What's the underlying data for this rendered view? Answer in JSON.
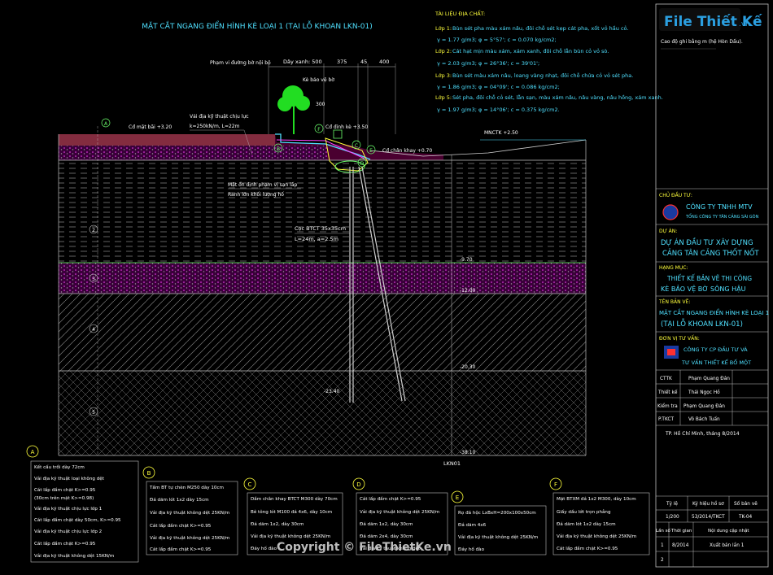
{
  "watermark": {
    "logo": "File Thiết Kế",
    "domain": ".vn",
    "copyright": "Copyright © FileThietKe.vn"
  },
  "title": "MẶT CẮT NGANG ĐIỂN HÌNH KÈ LOẠI 1 (TẠI LỖ KHOAN LKN-01)",
  "geology": {
    "header": "TÀI LIỆU ĐỊA CHẤT:",
    "layers": [
      {
        "name": "Lớp 1:",
        "desc": "Bùn sét pha màu xám nâu, đôi chỗ sét kẹp cát pha, xốt vỏ hầu cỏ.",
        "props": "γ = 1.77 g/m3; φ = 5°57'; c = 0.070 kg/cm2;"
      },
      {
        "name": "Lớp 2:",
        "desc": "Cát hạt mịn màu xám, xám xanh, đôi chỗ lẫn bùn cỏ vỏ sò.",
        "props": "γ = 2.03 g/m3; φ = 26°36'; c = 39'01';"
      },
      {
        "name": "Lớp 3:",
        "desc": "Bùn sét màu xám nâu, loang vàng nhạt, đôi chỗ chứa cỏ vỏ sét pha.",
        "props": "γ = 1.86 g/m3; φ = 04°09'; c = 0.086 kg/cm2;"
      },
      {
        "name": "Lớp 5:",
        "desc": "Sét pha, đôi chỗ cỏ sét, lẫn sạn, màu xám nâu, nâu vàng, nâu hồng, xám xanh.",
        "props": "γ = 1.97 g/m3; φ = 14°06'; c = 0.375 kg/cm2."
      }
    ]
  },
  "notes_right": [
    "Cao độ ghi bằng m (hệ Hòn Dấu)."
  ],
  "dims": [
    "Dây xanh: 500",
    "375",
    "45",
    "400",
    "300"
  ],
  "annotations": {
    "pham_vi": "Phạm vi đường bờ nội bộ",
    "ke_bao": "Kè bảo vệ bờ",
    "vai": "Vải địa kỹ thuật chịu lực",
    "vai2": "k=250kN/m, L=22m",
    "cd_mat_bai": "Cđ mặt bãi +3.20",
    "cd_dinh_ke": "Cđ đỉnh kè +3.50",
    "cd_chan_khay": "Cđ chân khay +0.70",
    "mnctk": "MNCTK +2.50",
    "mat_truot1": "Mặt ổn định phạm vị sạn lấp",
    "mat_truot2": "Ranh lớn khối lượng hố",
    "coc1": "Cọc BTCT 35x35cm",
    "coc2": "L=24m, a=2.5m",
    "pile_tip": "-23.40"
  },
  "elevations": [
    "-9.70",
    "-12.00",
    "-20.30",
    "-38.10"
  ],
  "layer_ids": [
    "1",
    "2",
    "3",
    "4",
    "5"
  ],
  "bottom_label": "LKN01",
  "callouts": [
    {
      "id": "A",
      "lines": [
        "Kết cấu trồi dày 72cm",
        "Vải địa kỹ thuật loại không dệt",
        "Cát lấp đầm chặt K>=0.95",
        "(30cm trên mặt K>=0.98)",
        "Vải địa kỹ thuật chịu lực lớp 1",
        "Cát lấp đầm chặt dày 50cm, K>=0.95",
        "Vải địa kỹ thuật chịu lực lớp 2",
        "Cát lấp đầm chặt K>=0.95",
        "Vải địa kỹ thuật không dệt 15KN/m"
      ]
    },
    {
      "id": "B",
      "lines": [
        "Tấm BT tự chèn M250 dày 10cm",
        "Đá dăm lót 1x2 dày 15cm",
        "Vải địa kỹ thuật không dệt 25KN/m",
        "Cát lấp đầm chặt K>=0.95",
        "Vải địa kỹ thuật không dệt 25KN/m",
        "Cát lấp đầm chặt K>=0.95"
      ]
    },
    {
      "id": "C",
      "lines": [
        "Dầm chân khay BTCT M300 dày 70cm",
        "Bê tông lót M100 đá 4x6, dày 10cm",
        "Đá dăm 1x2, dày 30cm",
        "Vải địa kỹ thuật không dệt 25KN/m",
        "Đáy hố đào"
      ]
    },
    {
      "id": "D",
      "lines": [
        "Cát lấp đầm chặt K>=0.95",
        "Vải địa kỹ thuật không dệt 25KN/m",
        "Đá dăm 1x2, dày 30cm",
        "Đá dăm 2x4, dày 30cm",
        "Vải địa kỹ thuật không dệt"
      ]
    },
    {
      "id": "E",
      "lines": [
        "Rọ đá hộc LxBxH=200x100x50cm",
        "Đá dăm 4x6",
        "Vải địa kỹ thuật không dệt 25KN/m",
        "Đáy hố đào"
      ]
    },
    {
      "id": "F",
      "lines": [
        "Mặt BTXM đá 1x2 M300, dày 10cm",
        "Giấy dầu lớt trọn phẳng",
        "Đá dăm lót 1x2 dày 15cm",
        "Vải địa kỹ thuật không dệt 25KN/m",
        "Cát lấp đầm chặt K>=0.95"
      ]
    }
  ],
  "titleblock": {
    "chu_dau_tu_h": "CHỦ ĐẦU TƯ:",
    "chu_dau_tu": [
      "CÔNG TY TNHH MTV",
      "TỔNG CÔNG TY TÂN CẢNG SÀI GÒN"
    ],
    "du_an_h": "DỰ ÁN:",
    "du_an": [
      "DỰ ÁN ĐẦU TƯ XÂY DỰNG",
      "CẢNG TÂN CẢNG THỐT NỐT"
    ],
    "hang_muc_h": "HẠNG MỤC:",
    "hang_muc": [
      "THIẾT KẾ BẢN VẼ THI CÔNG",
      "KÈ BẢO VỆ BỜ SÔNG HẬU"
    ],
    "ten_ban_ve_h": "TÊN BẢN VẼ:",
    "ten_ban_ve": [
      "MẶT CẮT NGANG ĐIỂN HÌNH KÈ LOẠI 1",
      "(TẠI LỖ KHOAN LKN-01)"
    ],
    "don_vi_h": "ĐƠN VỊ TƯ VẤN:",
    "don_vi": [
      "CÔNG TY CP ĐẦU TƯ VÀ",
      "TƯ VẤN THIẾT KẾ BỐ MỘT"
    ],
    "staff": [
      {
        "role": "CTTK",
        "name": "Phạm Quang Đản"
      },
      {
        "role": "Thiết kế",
        "name": "Thái Ngọc Hồ"
      },
      {
        "role": "Kiểm tra",
        "name": "Phạm Quang Đản"
      },
      {
        "role": "P.TKCT",
        "name": "Võ Bách Tuấn"
      }
    ],
    "place_date": "TP. Hồ Chí Minh, tháng 8/2014",
    "info_headers": [
      "Tỷ lệ",
      "Ký hiệu hồ sơ",
      "Số bản vẽ"
    ],
    "info_values": [
      "1/200",
      "53/2014/TKCT",
      "TK-04"
    ],
    "rev_headers": [
      "Lần số",
      "Thời gian",
      "Nội dung cập nhật"
    ],
    "revs": [
      {
        "n": "1",
        "date": "8/2014",
        "content": "Xuất bản lần 1"
      },
      {
        "n": "2",
        "date": "",
        "content": ""
      }
    ]
  },
  "colors": {
    "cyan": "#4fe0ff",
    "yellow": "#ffff3c",
    "green": "#6cff6c",
    "magenta": "#c000c0",
    "white": "#ffffff",
    "gray": "#8a8a8a"
  }
}
